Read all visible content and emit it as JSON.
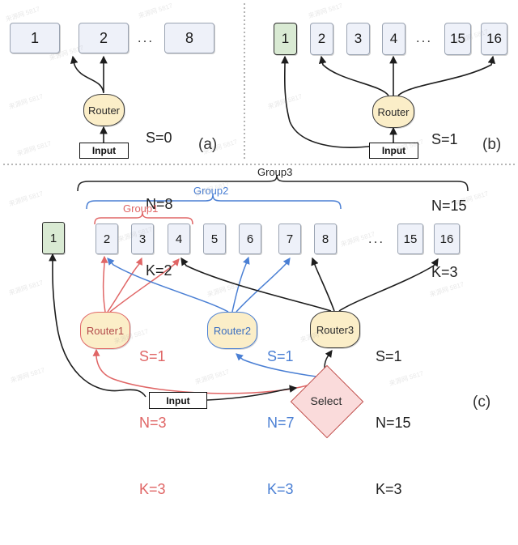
{
  "figure": {
    "panels": [
      {
        "id": "a",
        "label": "(a)",
        "experts": [
          {
            "id": "a1",
            "label": "1",
            "state": "inactive"
          },
          {
            "id": "a2",
            "label": "2",
            "state": "inactive"
          },
          {
            "id": "a3",
            "label": "8",
            "state": "inactive"
          }
        ],
        "ellipsis": "...",
        "router": {
          "label": "Router",
          "color": "#3a3a3a"
        },
        "input": {
          "label": "Input"
        },
        "params": {
          "S": "S=0",
          "N": "N=8",
          "K": "K=2"
        }
      },
      {
        "id": "b",
        "label": "(b)",
        "experts": [
          {
            "id": "b1",
            "label": "1",
            "state": "active"
          },
          {
            "id": "b2",
            "label": "2",
            "state": "inactive"
          },
          {
            "id": "b3",
            "label": "3",
            "state": "inactive"
          },
          {
            "id": "b4",
            "label": "4",
            "state": "inactive"
          },
          {
            "id": "b15",
            "label": "15",
            "state": "inactive"
          },
          {
            "id": "b16",
            "label": "16",
            "state": "inactive"
          }
        ],
        "ellipsis": "...",
        "router": {
          "label": "Router",
          "color": "#3a3a3a"
        },
        "input": {
          "label": "Input"
        },
        "params": {
          "S": "S=1",
          "N": "N=15",
          "K": "K=3"
        }
      },
      {
        "id": "c",
        "label": "(c)",
        "experts": [
          {
            "id": "c1",
            "label": "1",
            "state": "active"
          },
          {
            "id": "c2",
            "label": "2",
            "state": "inactive"
          },
          {
            "id": "c3",
            "label": "3",
            "state": "inactive"
          },
          {
            "id": "c4",
            "label": "4",
            "state": "inactive"
          },
          {
            "id": "c5",
            "label": "5",
            "state": "inactive"
          },
          {
            "id": "c6",
            "label": "6",
            "state": "inactive"
          },
          {
            "id": "c7",
            "label": "7",
            "state": "inactive"
          },
          {
            "id": "c8",
            "label": "8",
            "state": "inactive"
          },
          {
            "id": "c15",
            "label": "15",
            "state": "inactive"
          },
          {
            "id": "c16",
            "label": "16",
            "state": "inactive"
          }
        ],
        "ellipsis": "...",
        "groups": [
          {
            "id": "group1",
            "label": "Group1",
            "color": "#e06666",
            "covers": [
              "2",
              "3",
              "4"
            ]
          },
          {
            "id": "group2",
            "label": "Group2",
            "color": "#4a7fd4",
            "covers": [
              "2",
              "3",
              "4",
              "5",
              "6",
              "7",
              "8"
            ]
          },
          {
            "id": "group3",
            "label": "Group3",
            "color": "#222222",
            "covers": [
              "2",
              "3",
              "4",
              "5",
              "6",
              "7",
              "8",
              "15",
              "16"
            ]
          }
        ],
        "routers": [
          {
            "id": "router1",
            "label": "Router1",
            "color": "#e06666",
            "params": {
              "S": "S=1",
              "N": "N=3",
              "K": "K=3"
            },
            "targets": [
              "2",
              "3",
              "4"
            ]
          },
          {
            "id": "router2",
            "label": "Router2",
            "color": "#4a7fd4",
            "params": {
              "S": "S=1",
              "N": "N=7",
              "K": "K=3"
            },
            "targets": [
              "2",
              "6",
              "7"
            ]
          },
          {
            "id": "router3",
            "label": "Router3",
            "color": "#222222",
            "params": {
              "S": "S=1",
              "N": "N=15",
              "K": "K=3"
            },
            "targets": [
              "4",
              "8",
              "16"
            ]
          }
        ],
        "select": {
          "label": "Select"
        },
        "input": {
          "label": "Input"
        }
      }
    ]
  }
}
